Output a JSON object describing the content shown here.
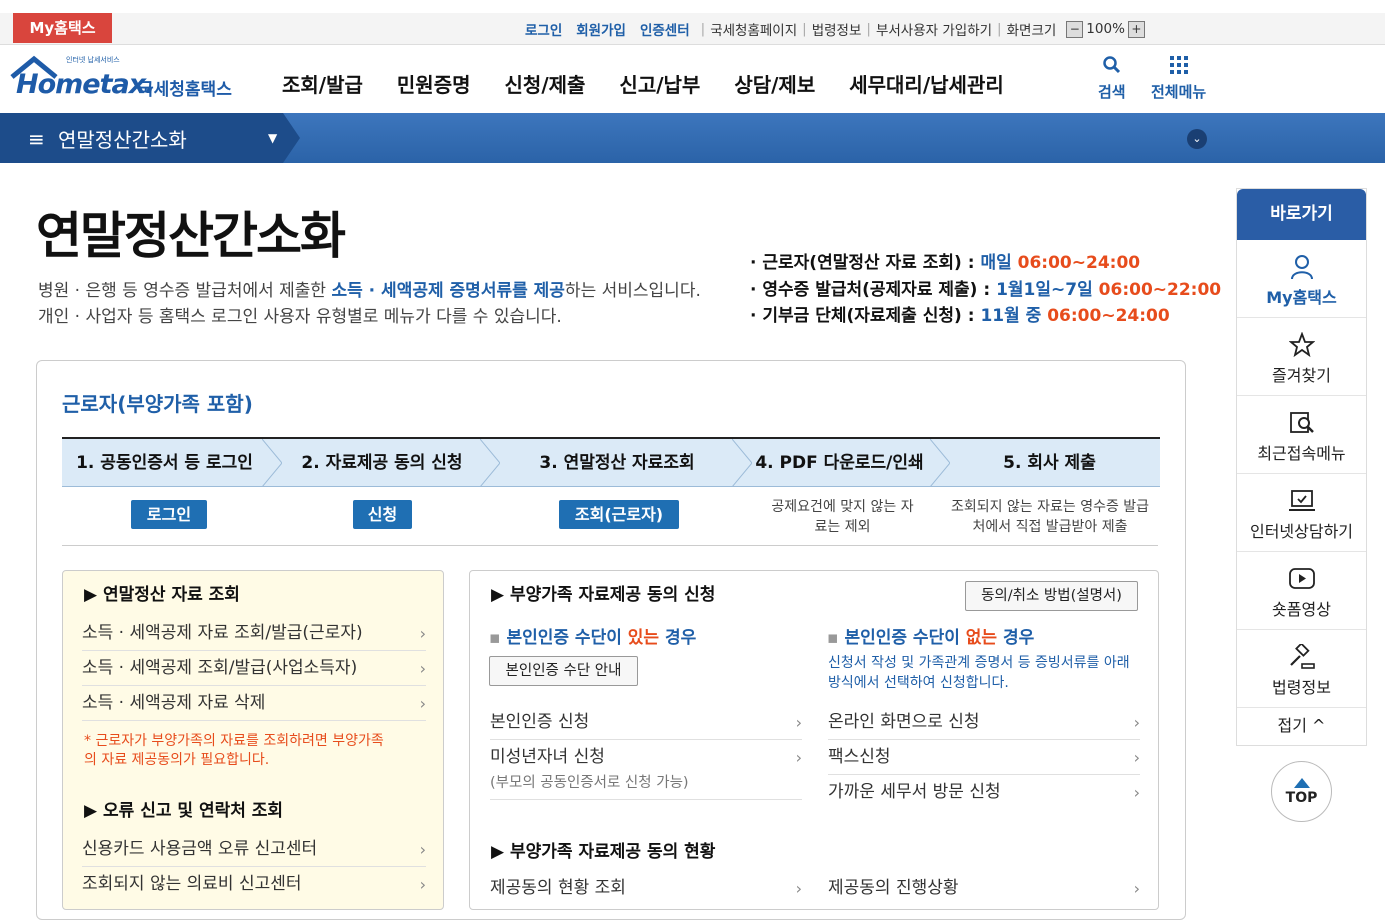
{
  "top": {
    "my_label": "My홈택스",
    "login": "로그인",
    "join": "회원가입",
    "cert": "인증센터",
    "links": [
      "국세청홈페이지",
      "법령정보",
      "부서사용자 가입하기",
      "화면크기"
    ],
    "zoom": "100%"
  },
  "logo": {
    "small": "인터넷 납세서비스",
    "main": "Hometax.",
    "kr": "국세청홈택스"
  },
  "nav": [
    "조회/발급",
    "민원증명",
    "신청/제출",
    "신고/납부",
    "상담/제보",
    "세무대리/납세관리"
  ],
  "header_icons": {
    "search": "검색",
    "all_menu": "전체메뉴"
  },
  "bar": {
    "title": "연말정산간소화"
  },
  "page": {
    "title": "연말정산간소화",
    "desc1_a": "병원 · 은행 등 영수증 발급처에서 제출한 ",
    "desc1_hl": "소득 · 세액공제 증명서류를 제공",
    "desc1_b": "하는 서비스입니다.",
    "desc2": "개인 · 사업자 등 홈택스 로그인 사용자 유형별로 메뉴가 다를 수 있습니다."
  },
  "schedule": [
    {
      "label": "· 근로자(연말정산 자료 조회) : ",
      "period": "매일 ",
      "time": "06:00~24:00"
    },
    {
      "label": "· 영수증 발급처(공제자료 제출) : ",
      "period": "1월1일~7일 ",
      "time": "06:00~22:00"
    },
    {
      "label": "· 기부금 단체(자료제출 신청) : ",
      "period": "11월 중 ",
      "time": "06:00~24:00"
    }
  ],
  "card": {
    "title": "근로자(부양가족 포함)",
    "steps": [
      "1. 공동인증서 등 로그인",
      "2. 자료제공 동의 신청",
      "3. 연말정산 자료조회",
      "4. PDF 다운로드/인쇄",
      "5. 회사 제출"
    ],
    "step_buttons": [
      "로그인",
      "신청",
      "조회(근로자)"
    ],
    "step_notes": [
      "공제요건에 맞지 않는 자료는 제외",
      "조회되지 않는 자료는 영수증 발급처에서 직접 발급받아 제출"
    ]
  },
  "left": {
    "sec1": "▶ 연말정산 자료 조회",
    "items1": [
      "소득 · 세액공제 자료 조회/발급(근로자)",
      "소득 · 세액공제 조회/발급(사업소득자)",
      "소득 · 세액공제 자료 삭제"
    ],
    "note": "* 근로자가 부양가족의 자료를 조회하려면 부양가족의 자료 제공동의가 필요합니다.",
    "sec2": "▶ 오류 신고 및 연락처 조회",
    "items2": [
      "신용카드 사용금액 오류 신고센터",
      "조회되지 않는 의료비 신고센터"
    ]
  },
  "right": {
    "sec1": "▶ 부양가족 자료제공 동의 신청",
    "guide_btn": "동의/취소 방법(설명서)",
    "sub1_a": "본인인증 수단이 ",
    "sub1_b": "있는",
    "sub1_c": " 경우",
    "cert_btn": "본인인증 수단 안내",
    "sub2_a": "본인인증 수단이 ",
    "sub2_b": "없는",
    "sub2_c": " 경우",
    "sub2_note": "신청서 작성 및 가족관계 증명서 등 증빙서류를 아래 방식에서 선택하여 신청합니다.",
    "left_items": [
      "본인인증 신청",
      "미성년자녀 신청"
    ],
    "minor_note": "(부모의 공동인증서로 신청 가능)",
    "right_items": [
      "온라인 화면으로 신청",
      "팩스신청",
      "가까운 세무서 방문 신청"
    ],
    "sec2": "▶ 부양가족 자료제공 동의 현황",
    "bottom_left": "제공동의 현황 조회",
    "bottom_right": "제공동의 진행상황"
  },
  "side": {
    "head": "바로가기",
    "items": [
      "My홈택스",
      "즐겨찾기",
      "최근접속메뉴",
      "인터넷상담하기",
      "숏폼영상",
      "법령정보"
    ],
    "fold": "접기 ^",
    "top": "TOP"
  }
}
